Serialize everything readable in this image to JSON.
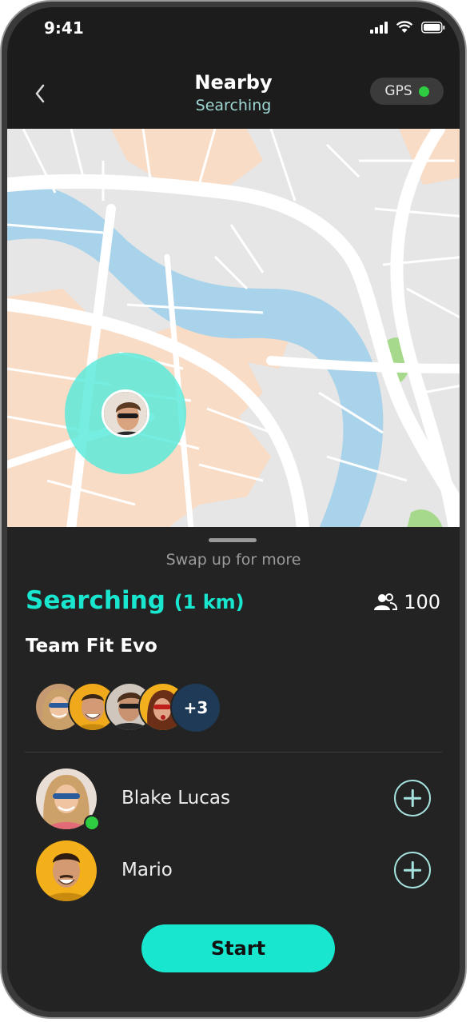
{
  "status_bar": {
    "time": "9:41"
  },
  "header": {
    "title": "Nearby",
    "subtitle": "Searching",
    "gps_label": "GPS"
  },
  "colors": {
    "accent": "#19e6cf",
    "online": "#2ecc40",
    "badge": "#1f3a56"
  },
  "sheet": {
    "hint": "Swap up for more",
    "search_label": "Searching",
    "search_radius": "(1 km)",
    "member_count": "100",
    "team_name": "Team Fit Evo",
    "more_count": "+3"
  },
  "people": [
    {
      "name": "Blake Lucas",
      "online": true
    },
    {
      "name": "Mario",
      "online": false
    }
  ],
  "actions": {
    "start_label": "Start"
  }
}
